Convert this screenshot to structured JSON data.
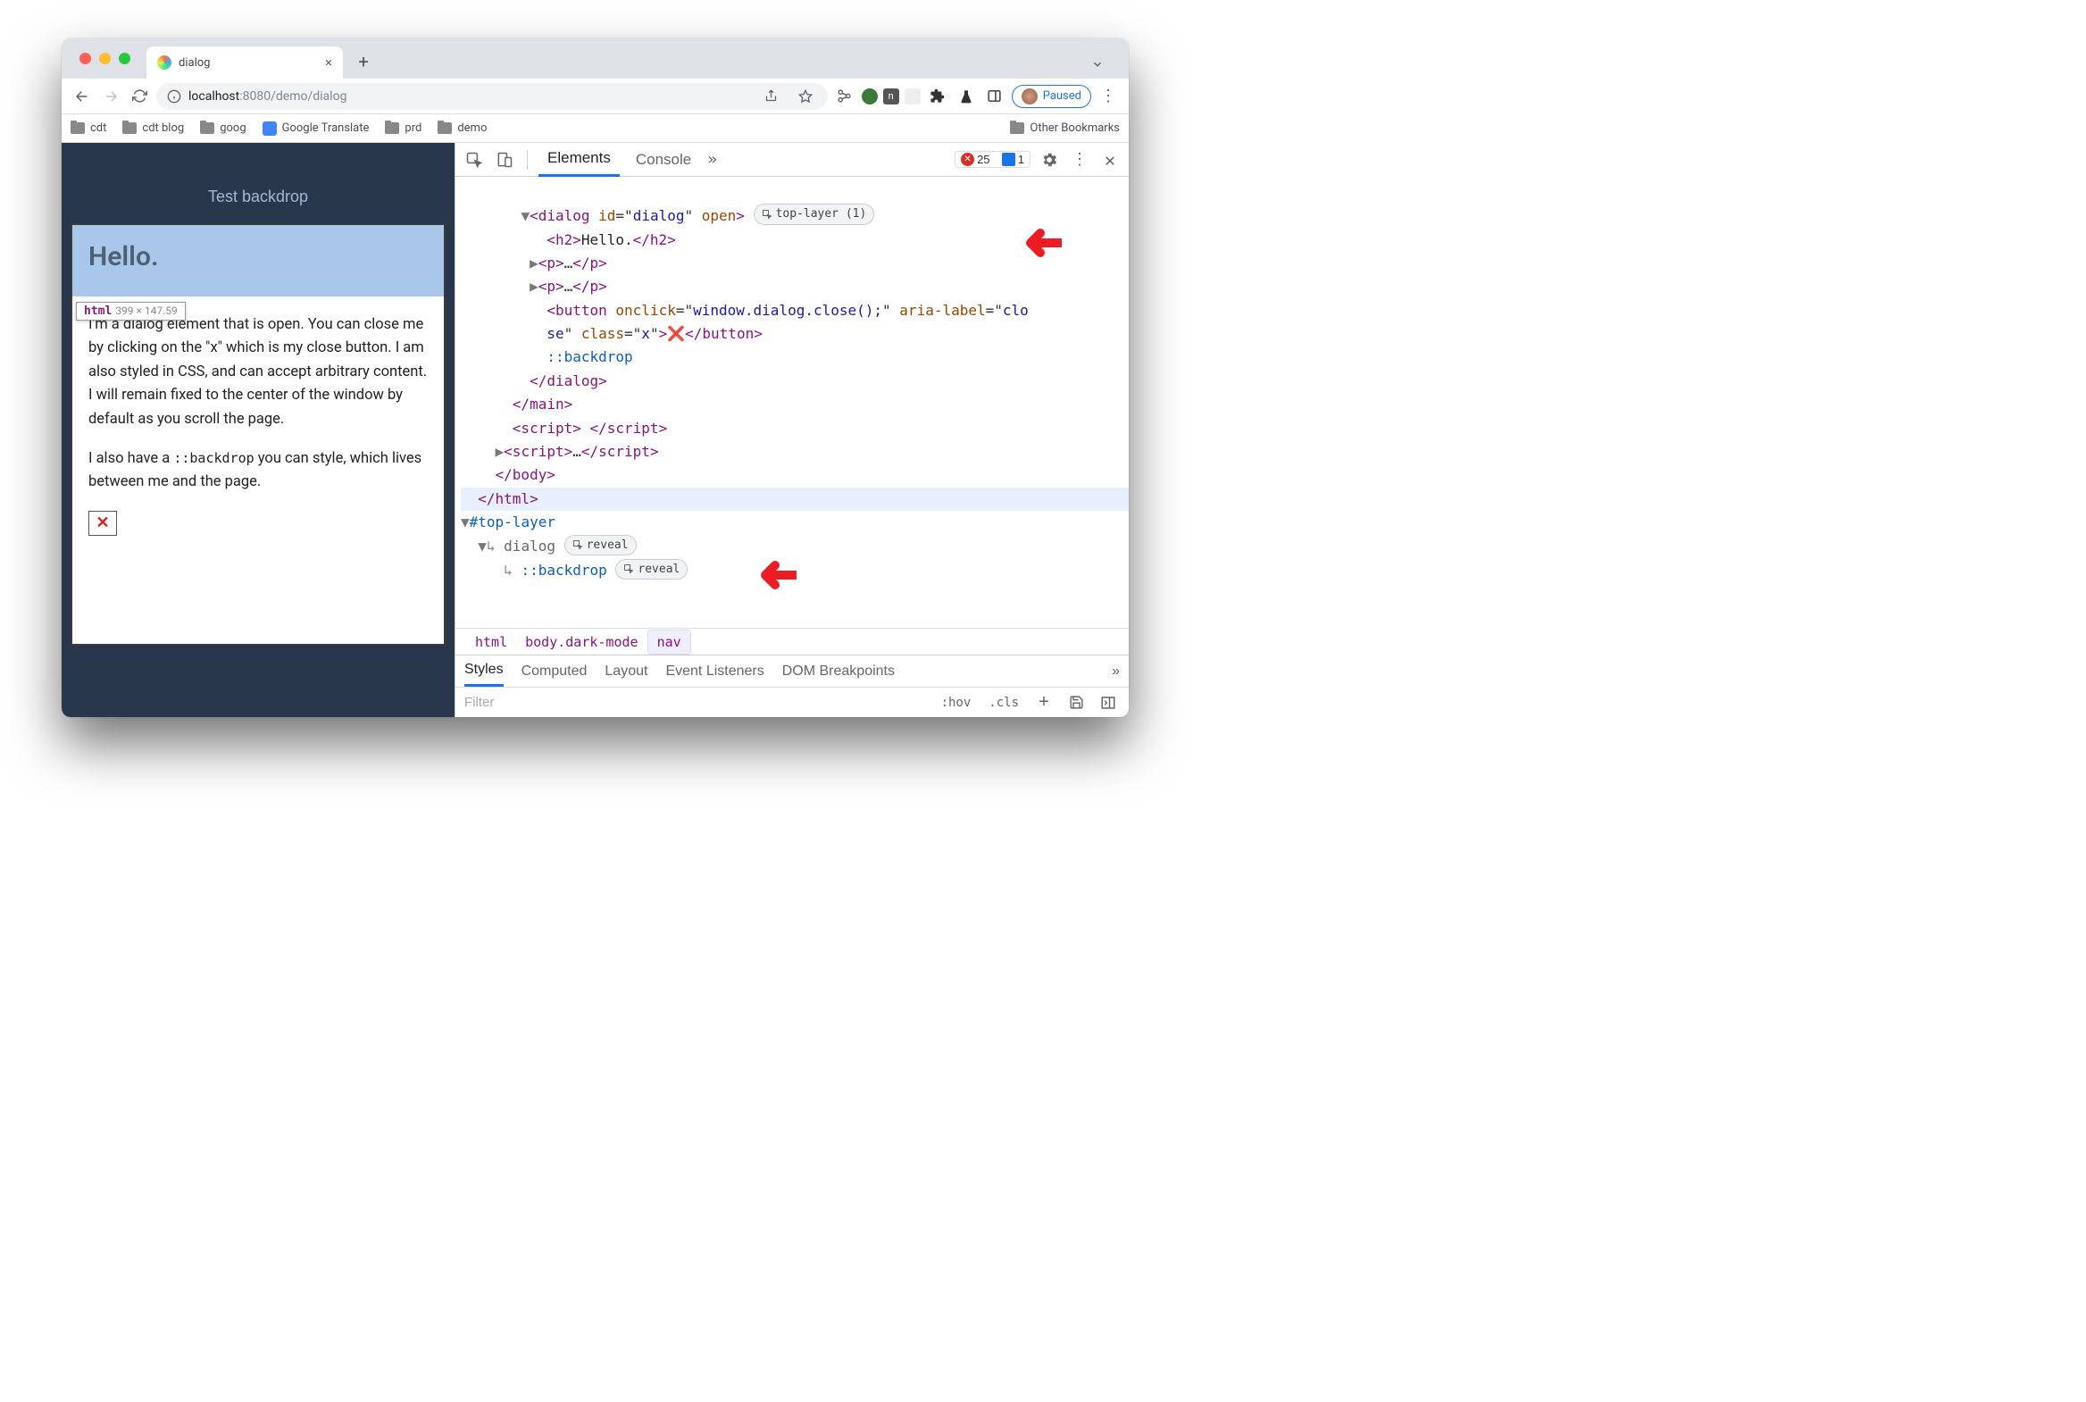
{
  "window": {
    "tab_title": "dialog",
    "url_protocol_host": "localhost",
    "url_port": ":8080",
    "url_path": "/demo/dialog",
    "paused_label": "Paused",
    "bookmarks": [
      "cdt",
      "cdt blog",
      "goog",
      "Google Translate",
      "prd",
      "demo"
    ],
    "other_bookmarks": "Other Bookmarks"
  },
  "page": {
    "button_label": "Test backdrop",
    "dialog_heading": "Hello.",
    "tooltip_tag": "html",
    "tooltip_dims": "399 × 147.59",
    "para1": "I'm a dialog element that is open. You can close me by clicking on the \"x\" which is my close button. I am also styled in CSS, and can accept arbitrary content. I will remain fixed to the center of the window by default as you scroll the page.",
    "para2_a": "I also have a ",
    "para2_code": "::backdrop",
    "para2_b": " you can style, which lives between me and the page.",
    "close_x": "✕"
  },
  "devtools": {
    "tabs": {
      "elements": "Elements",
      "console": "Console"
    },
    "error_count": "25",
    "issue_count": "1",
    "top_layer_badge": "top-layer (1)",
    "reveal_label": "reveal",
    "dom": {
      "dialog_open": "<dialog id=\"dialog\" open>",
      "h2": "<h2>Hello.</h2>",
      "p_collapsed": "<p>…</p>",
      "button_line1": "<button onclick=\"window.dialog.close();\" aria-label=\"clo",
      "button_line2": "se\" class=\"x\">❌</button>",
      "backdrop_pe": "::backdrop",
      "dialog_close": "</dialog>",
      "main_close": "</main>",
      "script1": "<script> </scr",
      "script_suf": "ipt>",
      "script2a": "<script>…</scr",
      "body_close": "</body>",
      "html_close": "</html>",
      "toplayer": "#top-layer",
      "tl_dialog": "dialog",
      "tl_backdrop": "::backdrop"
    },
    "crumbs": [
      "html",
      "body.dark-mode",
      "nav"
    ],
    "styles_tabs": [
      "Styles",
      "Computed",
      "Layout",
      "Event Listeners",
      "DOM Breakpoints"
    ],
    "filter_placeholder": "Filter",
    "filter_btns": [
      ":hov",
      ".cls"
    ]
  }
}
